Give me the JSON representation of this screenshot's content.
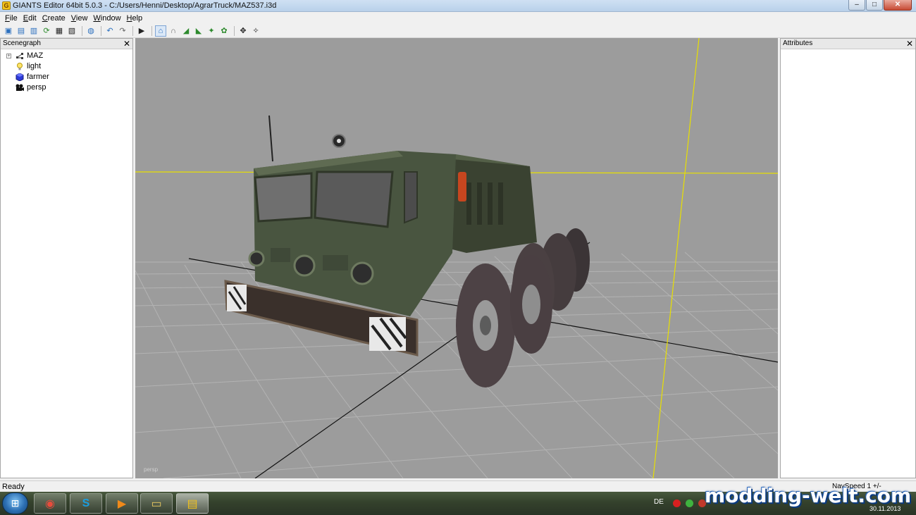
{
  "window": {
    "title": "GIANTS Editor 64bit 5.0.3 - C:/Users/Henni/Desktop/AgrarTruck/MAZ537.i3d",
    "app_icon_letter": "G",
    "controls": {
      "minimize": "–",
      "maximize": "□",
      "close": "✕"
    }
  },
  "menu": {
    "file": {
      "underlined": "F",
      "rest": "ile"
    },
    "edit": {
      "underlined": "E",
      "rest": "dit"
    },
    "create": {
      "underlined": "C",
      "rest": "reate"
    },
    "view": {
      "underlined": "V",
      "rest": "iew"
    },
    "window": {
      "underlined": "W",
      "rest": "indow"
    },
    "help": {
      "underlined": "H",
      "rest": "elp"
    }
  },
  "toolbar": {
    "icons": [
      "new-file-icon",
      "open-folder-icon",
      "import-icon",
      "reload-icon",
      "save-icon",
      "save-all-icon",
      "script-icon",
      "undo-icon",
      "redo-icon",
      "play-icon",
      "select-tool-icon",
      "move-tool-icon",
      "terrain-sculpt-icon",
      "terrain-paint-icon",
      "foliage-icon",
      "grass-icon",
      "snap-icon",
      "snap-settings-icon"
    ],
    "glyphs": {
      "new": "▣",
      "open": "▤",
      "import": "▥",
      "reload": "⟳",
      "save": "▦",
      "save_all": "▧",
      "script": "◍",
      "undo": "↶",
      "redo": "↷",
      "play": "▶",
      "select": "⌂",
      "move": "∩",
      "sculpt": "◢",
      "paint": "◣",
      "foliage": "✦",
      "grass": "✿",
      "snap": "✥",
      "snap_settings": "✧"
    }
  },
  "scenegraph": {
    "title": "Scenegraph",
    "close": "✕",
    "items": [
      {
        "label": "MAZ",
        "expander": "+"
      },
      {
        "label": "light"
      },
      {
        "label": "farmer"
      },
      {
        "label": "persp"
      }
    ]
  },
  "attributes": {
    "title": "Attributes",
    "close": "✕"
  },
  "viewport": {
    "camera_label": "persp",
    "background": "#9c9c9c",
    "axis_color": "#e8e000"
  },
  "statusbar": {
    "status": "Ready",
    "nav_speed": "NavSpeed 1 +/-"
  },
  "taskbar": {
    "start_glyph": "⊞",
    "tasks": [
      {
        "name": "chrome",
        "glyph": "◉"
      },
      {
        "name": "skype",
        "glyph": "S"
      },
      {
        "name": "media-player",
        "glyph": "▶"
      },
      {
        "name": "file-explorer",
        "glyph": "▭"
      },
      {
        "name": "giants-editor",
        "glyph": "▤"
      }
    ],
    "language": "DE",
    "date": "30.11.2013"
  },
  "watermark": "modding-welt.com"
}
